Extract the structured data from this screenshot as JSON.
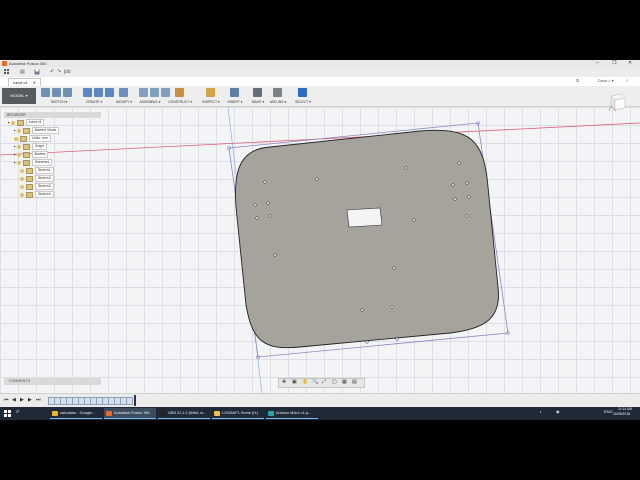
{
  "window": {
    "title": "Autodesk Fusion 360",
    "minimize_glyph": "–",
    "maximize_glyph": "❐",
    "close_glyph": "✕"
  },
  "quick_access": {
    "grid_icon": "grid-icon",
    "file_glyph": "▤",
    "save_glyph": "💾",
    "undo_glyph": "↶",
    "redo_glyph": "↷",
    "job_label": "job"
  },
  "document_tab": {
    "name": "robot v4",
    "close_glyph": "✕",
    "user_label": "Dave L ▾",
    "help_glyph": "?",
    "notify_glyph": "⏲"
  },
  "ribbon": {
    "workspace_label": "MODEL ▾",
    "groups": [
      {
        "label": "SKETCH ▾",
        "color": "#6f8fb3"
      },
      {
        "label": "CREATE ▾",
        "color": "#5a86c2"
      },
      {
        "label": "MODIFY ▾",
        "color": "#6b8fbf"
      },
      {
        "label": "ASSEMBLE ▾",
        "color": "#7e9fbe"
      },
      {
        "label": "CONSTRUCT ▾",
        "color": "#c98f3c"
      },
      {
        "label": "INSPECT ▾",
        "color": "#d2a447"
      },
      {
        "label": "INSERT ▾",
        "color": "#5b7ea6"
      },
      {
        "label": "MAKE ▾",
        "color": "#666d74"
      },
      {
        "label": "ADD-INS ▾",
        "color": "#7b8086"
      },
      {
        "label": "SELECT ▾",
        "color": "#2d6ec4"
      }
    ]
  },
  "browser": {
    "header": "BROWSER",
    "items": [
      {
        "label": "robot v4",
        "type": "root"
      },
      {
        "label": "Named Views",
        "type": "folder"
      },
      {
        "label": "Units: mm",
        "type": "item"
      },
      {
        "label": "Origin",
        "type": "folder"
      },
      {
        "label": "Bodies",
        "type": "folder"
      },
      {
        "label": "Sketches",
        "type": "folder"
      },
      {
        "label": "Sketch1",
        "type": "sketch"
      },
      {
        "label": "Sketch2",
        "type": "sketch"
      },
      {
        "label": "Sketch3",
        "type": "sketch"
      },
      {
        "label": "Sketch4",
        "type": "sketch"
      }
    ]
  },
  "viewcube": {
    "face_label": "FRONT"
  },
  "comments": {
    "label": "COMMENTS"
  },
  "nav_toolbar": {
    "glyphs": [
      "✥",
      "▣",
      "✋",
      "🔍",
      "⤢",
      "▢",
      "▦",
      "▤"
    ]
  },
  "timeline": {
    "controls": [
      "⏮",
      "◀",
      "▶",
      "▶",
      "⏭"
    ],
    "step_count": 14
  },
  "taskbar": {
    "search_glyph": "⌕",
    "items": [
      {
        "label": "calculator - Google...",
        "color": "#e9b52f",
        "active": false
      },
      {
        "label": "Autodesk Fusion 360",
        "color": "#f26a21",
        "active": true
      },
      {
        "label": "OBS 21.1.2 (64bit, w...",
        "color": "#222222",
        "active": false
      },
      {
        "label": "LOGANF1 Home (H:)",
        "color": "#f0c44c",
        "active": false
      },
      {
        "label": "Arduino Motor v1.p...",
        "color": "#2aa3a8",
        "active": false
      }
    ],
    "tray": {
      "lang": "ENG",
      "time": "11:14 AM",
      "date": "16/05/2018"
    }
  },
  "colors": {
    "accent": "#2d6ec4",
    "body_fill": "#a6a39c",
    "sketch_line": "#5a5aa8",
    "red_axis": "#e0607a"
  }
}
